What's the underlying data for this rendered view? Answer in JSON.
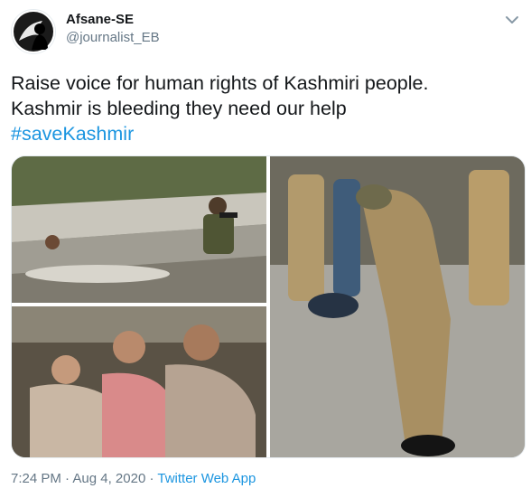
{
  "author": {
    "display_name": "Afsane-SE",
    "handle": "@journalist_EB",
    "avatar_icon": "silhouette-avatar-icon"
  },
  "menu_icon": "chevron-down-icon",
  "tweet": {
    "line1": "Raise voice for human rights of Kashmiri people.",
    "line2": "Kashmir is bleeding they need our help",
    "hashtag": "#saveKashmir"
  },
  "media": [
    {
      "name": "photo-man-lying-on-road"
    },
    {
      "name": "photo-officer-standing-over-people"
    },
    {
      "name": "photo-grieving-crowd"
    }
  ],
  "meta": {
    "time": "7:24 PM",
    "separator1": " · ",
    "date": "Aug 4, 2020",
    "separator2": " · ",
    "source": "Twitter Web App"
  },
  "colors": {
    "link": "#1b95e0",
    "secondary_text": "#657786",
    "primary_text": "#14171a"
  }
}
